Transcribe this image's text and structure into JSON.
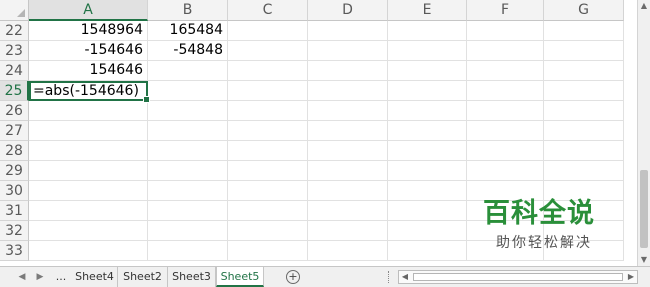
{
  "columns": [
    {
      "label": "A",
      "active": true
    },
    {
      "label": "B",
      "active": false
    },
    {
      "label": "C",
      "active": false
    },
    {
      "label": "D",
      "active": false
    },
    {
      "label": "E",
      "active": false
    },
    {
      "label": "F",
      "active": false
    },
    {
      "label": "G",
      "active": false
    }
  ],
  "rows": [
    {
      "num": "22",
      "A": "1548964",
      "B": "165484"
    },
    {
      "num": "23",
      "A": "-154646",
      "B": "-54848"
    },
    {
      "num": "24",
      "A": "154646",
      "B": ""
    },
    {
      "num": "25",
      "A": "=abs(-154646)",
      "B": "",
      "active": true
    },
    {
      "num": "26",
      "A": "",
      "B": ""
    },
    {
      "num": "27",
      "A": "",
      "B": ""
    },
    {
      "num": "28",
      "A": "",
      "B": ""
    },
    {
      "num": "29",
      "A": "",
      "B": ""
    },
    {
      "num": "30",
      "A": "",
      "B": ""
    },
    {
      "num": "31",
      "A": "",
      "B": ""
    },
    {
      "num": "32",
      "A": "",
      "B": ""
    },
    {
      "num": "33",
      "A": "",
      "B": ""
    }
  ],
  "tabs": {
    "ellipsis": "...",
    "sheets": [
      "Sheet4",
      "Sheet2",
      "Sheet3",
      "Sheet5"
    ],
    "active": "Sheet5",
    "add_symbol": "+"
  },
  "icons": {
    "tab_prev": "triangle-left-icon",
    "tab_next": "triangle-right-icon",
    "add_sheet": "plus-circle-icon",
    "scroll_up": "scroll-up-icon",
    "scroll_down": "scroll-down-icon",
    "scroll_left": "scroll-left-icon",
    "scroll_right": "scroll-right-icon"
  },
  "watermark": {
    "title": "百科全说",
    "subtitle": "助你轻松解决"
  },
  "colors": {
    "accent": "#217346",
    "watermark_green": "#2a8f3a"
  }
}
